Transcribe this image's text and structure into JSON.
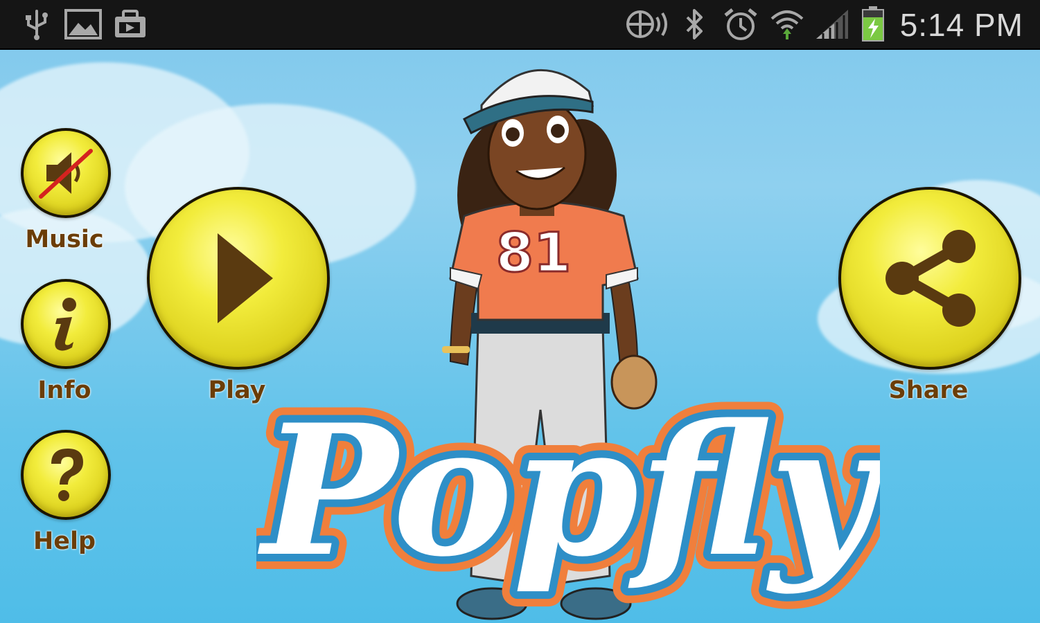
{
  "status_bar": {
    "time": "5:14 PM",
    "left_icons": [
      "usb-icon",
      "image-icon",
      "briefcase-icon"
    ],
    "right_icons": [
      "nfc-icon",
      "bluetooth-icon",
      "alarm-icon",
      "wifi-icon",
      "signal-icon",
      "battery-charging-icon"
    ],
    "background_color": "#151515"
  },
  "menu": {
    "music_label": "Music",
    "music_state": "muted",
    "info_label": "Info",
    "help_label": "Help",
    "play_label": "Play",
    "share_label": "Share"
  },
  "logo": {
    "title": "Popfly"
  },
  "character": {
    "jersey_number": "81"
  },
  "colors": {
    "button_yellow": "#e8e02c",
    "label_brown": "#6b3d07",
    "logo_orange": "#f07f3c",
    "logo_blue": "#2e8fc7",
    "sky_blue": "#62c3ea"
  }
}
